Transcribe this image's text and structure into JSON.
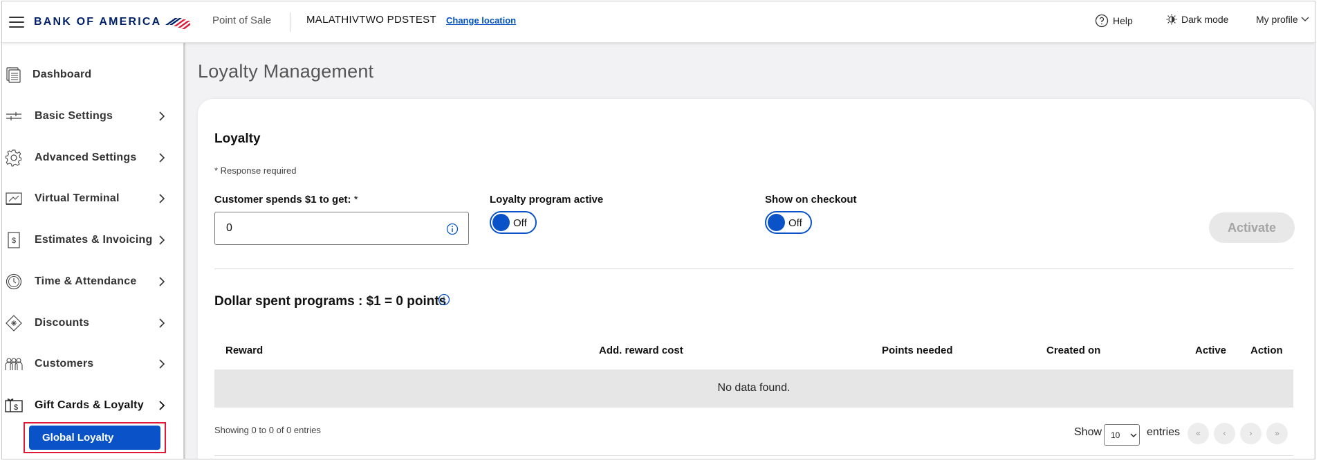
{
  "header": {
    "brand": "BANK OF AMERICA",
    "app_name": "Point of Sale",
    "merchant": "MALATHIVTWO PDSTEST",
    "change_location": "Change location",
    "help": "Help",
    "dark_mode": "Dark mode",
    "my_profile": "My profile"
  },
  "sidebar": {
    "items": [
      {
        "label": "Dashboard",
        "icon": "dashboard-icon",
        "has_chevron": false
      },
      {
        "label": "Basic Settings",
        "icon": "sliders-icon",
        "has_chevron": true
      },
      {
        "label": "Advanced Settings",
        "icon": "gear-icon",
        "has_chevron": true
      },
      {
        "label": "Virtual Terminal",
        "icon": "terminal-icon",
        "has_chevron": true
      },
      {
        "label": "Estimates & Invoicing",
        "icon": "invoice-icon",
        "has_chevron": true
      },
      {
        "label": "Time & Attendance",
        "icon": "clock-icon",
        "has_chevron": true
      },
      {
        "label": "Discounts",
        "icon": "tag-icon",
        "has_chevron": true
      },
      {
        "label": "Customers",
        "icon": "people-icon",
        "has_chevron": true
      },
      {
        "label": "Gift Cards & Loyalty",
        "icon": "gift-card-icon",
        "has_chevron": true
      }
    ],
    "active_sub_item": "Global Loyalty",
    "highlight_color": "#e31837",
    "accent_color": "#0a52c7"
  },
  "main": {
    "page_title": "Loyalty Management",
    "loyalty": {
      "title": "Loyalty",
      "required_note": "* Response required",
      "spend_label": "Customer spends $1 to get:",
      "required_mark": "*",
      "spend_value": "0",
      "program_active_label": "Loyalty program active",
      "program_active_state": "Off",
      "show_checkout_label": "Show on checkout",
      "show_checkout_state": "Off",
      "activate_button": "Activate"
    },
    "programs": {
      "title": "Dollar spent programs : $1 = 0 points",
      "columns": [
        "Reward",
        "Add. reward cost",
        "Points needed",
        "Created on",
        "Active",
        "Action"
      ],
      "rows": [],
      "empty_text": "No data found.",
      "footer": "Showing 0 to 0 of 0 entries",
      "show_label": "Show",
      "page_size": "10",
      "entries_label": "entries",
      "pagination": [
        "«",
        "‹",
        "›",
        "»"
      ]
    }
  }
}
